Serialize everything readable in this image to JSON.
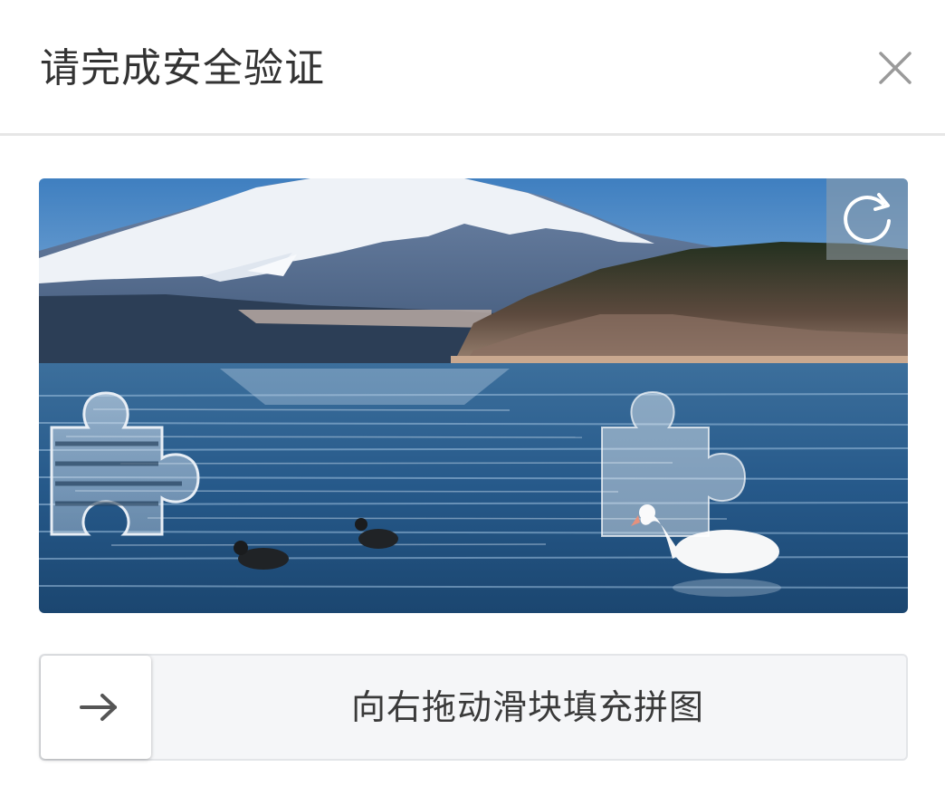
{
  "dialog": {
    "title": "请完成安全验证",
    "close_icon": "close-icon"
  },
  "captcha": {
    "refresh_icon": "refresh-icon",
    "scene_description_icon": "puzzle-background-image",
    "colors": {
      "sky": "#4b86c2",
      "water": "#245d8c",
      "snow": "#f2f4f7"
    }
  },
  "slider": {
    "hint": "向右拖动滑块填充拼图",
    "handle_icon": "arrow-right-icon",
    "track_color": "#f5f6f8"
  }
}
